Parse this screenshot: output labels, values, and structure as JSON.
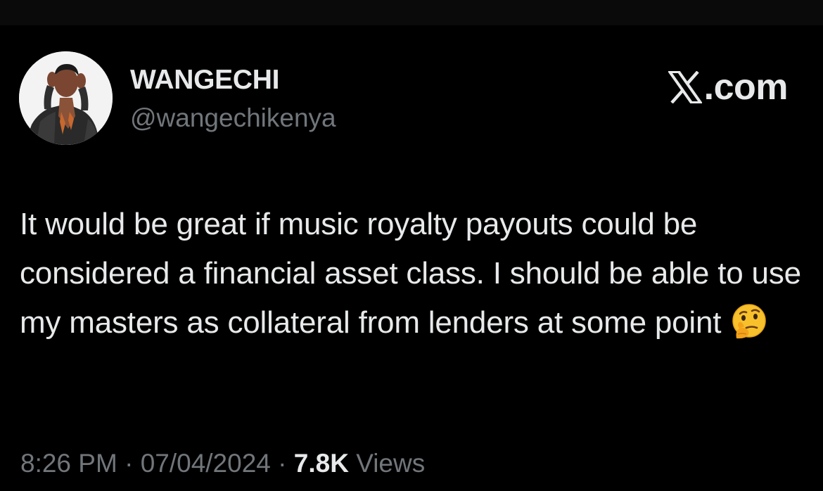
{
  "author": {
    "display_name": "WANGECHI",
    "handle": "@wangechikenya"
  },
  "brand": {
    "icon": "x-logo-icon",
    "text": ".com"
  },
  "tweet": {
    "text": "It would be great if music royalty payouts could be considered a financial asset class. I should be able to use my masters as collateral from lenders at some point",
    "emoji": "thinking-face-emoji"
  },
  "meta": {
    "time": "8:26 PM",
    "separator": "·",
    "date": "07/04/2024",
    "views_count": "7.8K",
    "views_label": "Views"
  },
  "colors": {
    "background": "#000000",
    "primary_text": "#e7e9ea",
    "secondary_text": "#71767b"
  }
}
